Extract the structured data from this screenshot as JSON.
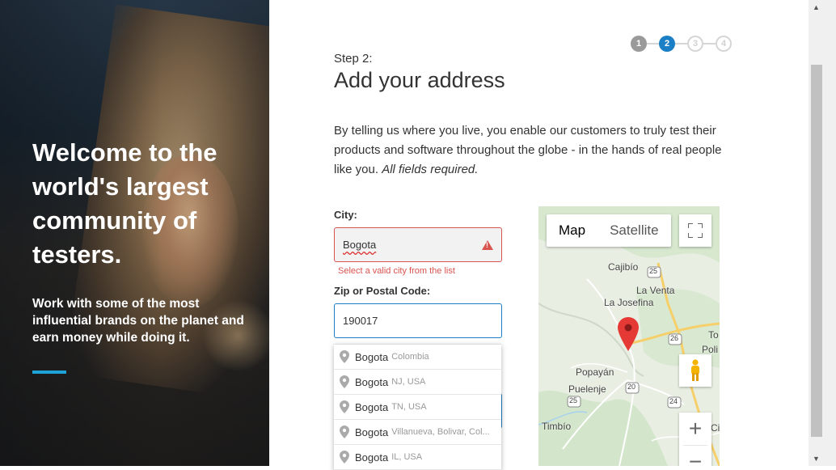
{
  "hero": {
    "title": "Welcome to the world's largest community of testers.",
    "subtitle": "Work with some of the most influential brands on the planet and earn money while doing it.",
    "accent_color": "#1ea3d8"
  },
  "progress": {
    "steps": [
      "1",
      "2",
      "3",
      "4"
    ],
    "current": 2,
    "active_color": "#1a7fc4"
  },
  "form": {
    "step_label": "Step 2:",
    "title": "Add your address",
    "intro": "By telling us where you live, you enable our customers to truly test their products and software throughout the globe - in the hands of real people like you.",
    "intro_emphasis": "All fields required.",
    "city_label": "City:",
    "city_value": "Bogota",
    "city_error": "Select a valid city from the list",
    "zip_label": "Zip or Postal Code:",
    "zip_value": "190017",
    "error_color": "#d9534f"
  },
  "autocomplete": [
    {
      "main": "Bogota",
      "secondary": "Colombia"
    },
    {
      "main": "Bogota",
      "secondary": "NJ, USA"
    },
    {
      "main": "Bogota",
      "secondary": "TN, USA"
    },
    {
      "main": "Bogota",
      "secondary": "Villanueva, Bolivar, Col..."
    },
    {
      "main": "Bogota",
      "secondary": "IL, USA"
    }
  ],
  "map": {
    "type_map": "Map",
    "type_satellite": "Satellite",
    "zoom_in": "+",
    "zoom_out": "−",
    "labels": {
      "cajibio": "Cajibío",
      "la_venta": "La Venta",
      "la_josefina": "La Josefina",
      "popayan": "Popayán",
      "puelenje": "Puelenje",
      "timbio": "Timbío",
      "to": "To",
      "poli": "Poli",
      "ci": "Ci"
    },
    "route_shields": [
      "25",
      "26",
      "20",
      "25",
      "24"
    ],
    "marker_color": "#e53935"
  }
}
